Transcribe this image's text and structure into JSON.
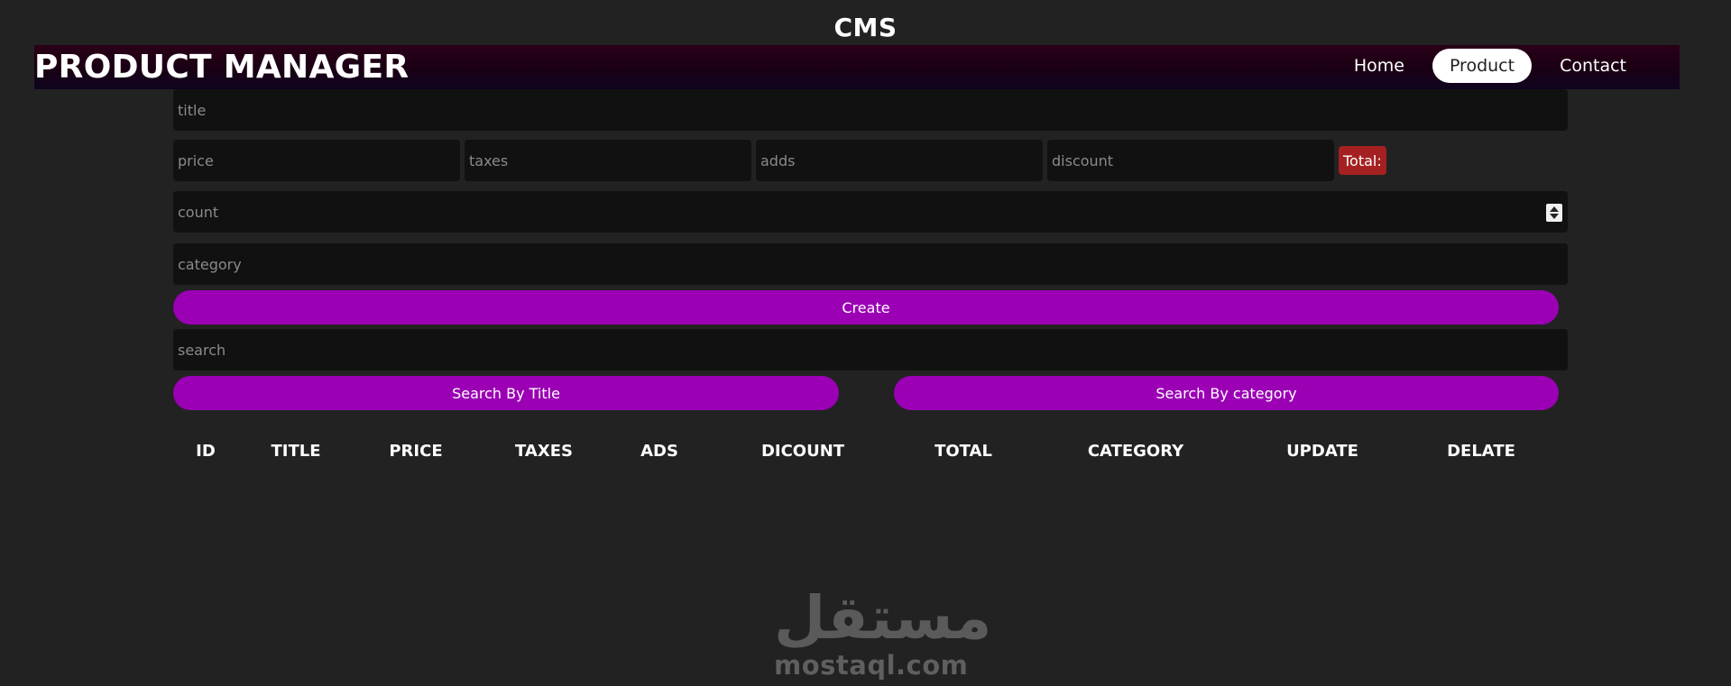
{
  "header": {
    "cms_title": "CMS",
    "brand": "PRODUCT MANAGER",
    "nav": [
      {
        "label": "Home"
      },
      {
        "label": "Product"
      },
      {
        "label": "Contact"
      }
    ]
  },
  "form": {
    "title_placeholder": "title",
    "price_placeholder": "price",
    "taxes_placeholder": "taxes",
    "adds_placeholder": "adds",
    "discount_placeholder": "discount",
    "total_label": "Total:",
    "count_placeholder": "count",
    "category_placeholder": "category",
    "create_label": "Create",
    "search_placeholder": "search",
    "search_title_label": "Search By Title",
    "search_category_label": "Search By category"
  },
  "table": {
    "headers": [
      "ID",
      "TITLE",
      "PRICE",
      "TAXES",
      "ADS",
      "DICOUNT",
      "TOTAL",
      "CATEGORY",
      "UPDATE",
      "DELATE"
    ]
  },
  "watermark": {
    "arabic": "مستقل",
    "latin": "mostaql.com"
  },
  "colors": {
    "background": "#222222",
    "input_bg": "#111111",
    "accent_purple": "#9b00b5",
    "total_red": "#a52121",
    "nav_active_bg": "#ffffff"
  }
}
